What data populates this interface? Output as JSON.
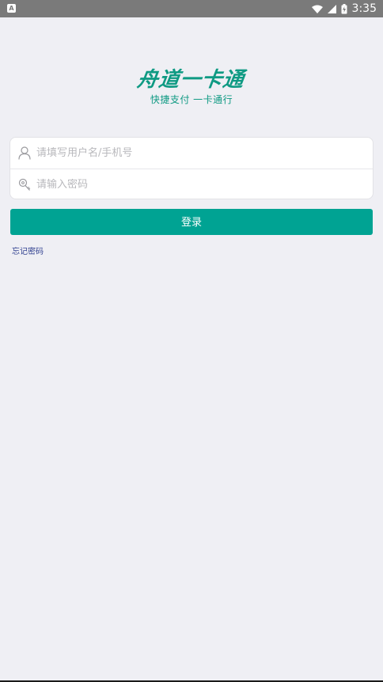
{
  "status_bar": {
    "notification_icon": "A",
    "time": "3:35",
    "icons": [
      "wifi-icon",
      "signal-icon",
      "battery-icon"
    ],
    "color": "#7a7a7a"
  },
  "logo": {
    "title": "舟道一卡通",
    "subtitle": "快捷支付 一卡通行",
    "color": "#0f9a83"
  },
  "form": {
    "username_placeholder": "请填写用户名/手机号",
    "username_value": "",
    "username_icon": "user-icon",
    "password_placeholder": "请输入密码",
    "password_value": "",
    "password_icon": "key-icon"
  },
  "login_button": {
    "label": "登录",
    "color": "#00a393"
  },
  "forgot_password": {
    "label": "忘记密码"
  }
}
